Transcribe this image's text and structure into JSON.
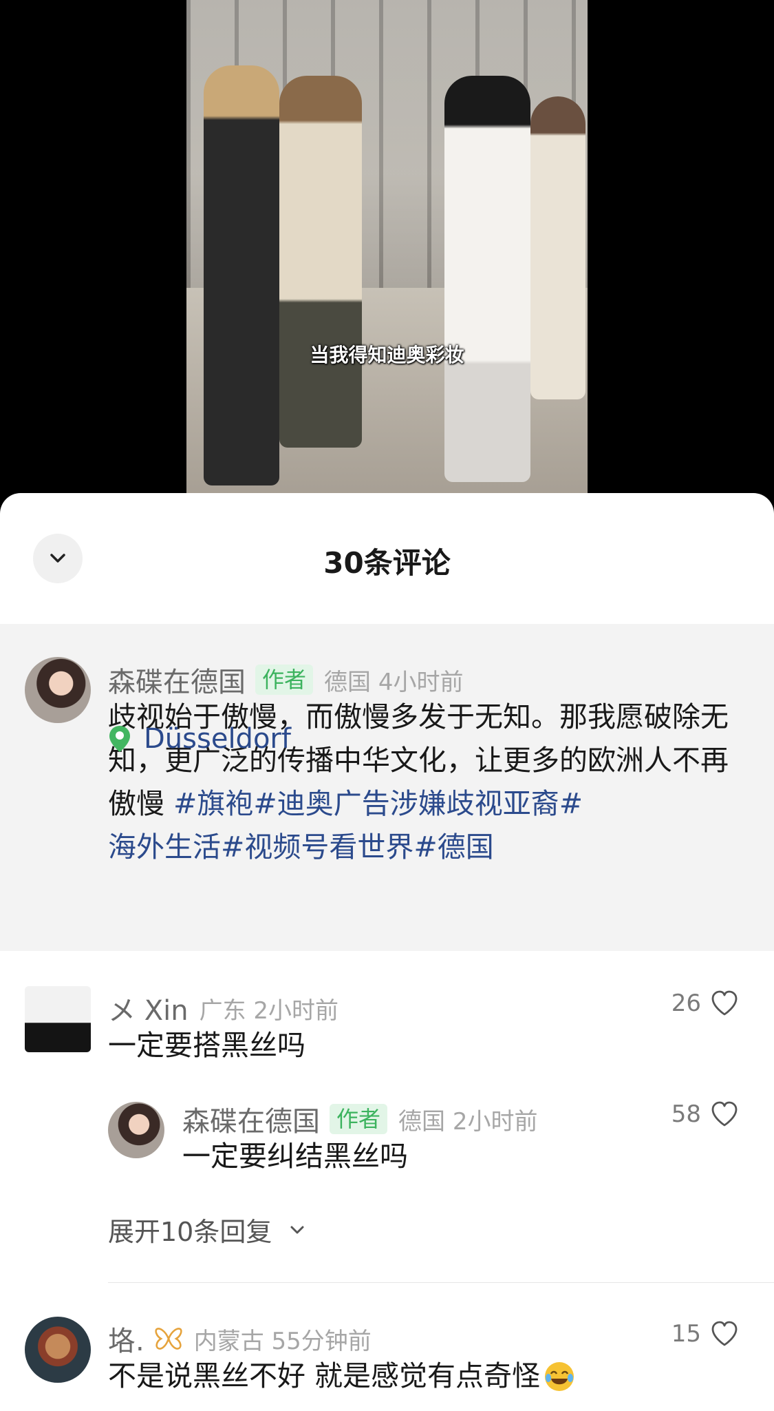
{
  "video": {
    "caption": "当我得知迪奥彩妆"
  },
  "sheet": {
    "title": "30条评论"
  },
  "author_post": {
    "name": "森碟在德国",
    "tag": "作者",
    "meta": "德国 4小时前",
    "text": "歧视始于傲慢，而傲慢多发于无知。那我愿破除无知，更广泛的传播中华文化，让更多的欧洲人不再傲慢 ",
    "hashtags_line1": "#旗袍#迪奥广告涉嫌歧视亚裔#",
    "hashtags_line2": "海外生活#视频号看世界#德国",
    "location": "Düsseldorf"
  },
  "comments": [
    {
      "name": "メ Xin",
      "meta": "广东 2小时前",
      "text": "一定要搭黑丝吗",
      "likes": "26",
      "reply": {
        "name": "森碟在德国",
        "tag": "作者",
        "meta": "德国 2小时前",
        "text": "一定要纠结黑丝吗",
        "likes": "58"
      },
      "expand_label": "展开10条回复"
    },
    {
      "name": "垎.",
      "meta": "内蒙古 55分钟前",
      "text": "不是说黑丝不好 就是感觉有点奇怪",
      "likes": "15"
    }
  ],
  "colors": {
    "author_tag": "#3cb35e",
    "hashtag": "#2b4a8c",
    "location_pin": "#43b661"
  }
}
